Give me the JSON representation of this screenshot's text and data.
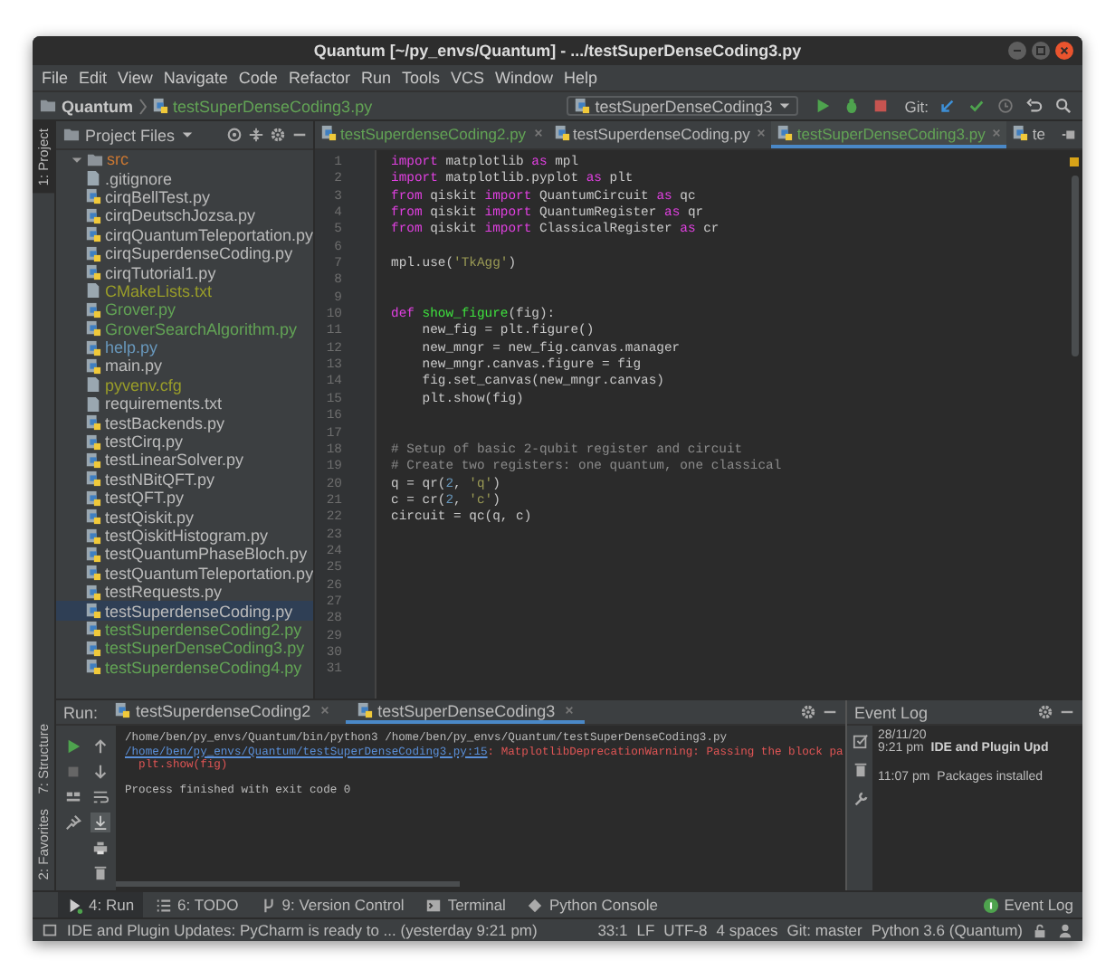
{
  "window": {
    "title": "Quantum [~/py_envs/Quantum] - .../testSuperDenseCoding3.py"
  },
  "menu": [
    "File",
    "Edit",
    "View",
    "Navigate",
    "Code",
    "Refactor",
    "Run",
    "Tools",
    "VCS",
    "Window",
    "Help"
  ],
  "navbar": {
    "project": "Quantum",
    "file": "testSuperDenseCoding3.py",
    "run_config": "testSuperDenseCoding3",
    "git_label": "Git:"
  },
  "side_tabs_top": [
    {
      "label": "1: Project",
      "selected": true
    }
  ],
  "side_tabs_bottom": [
    {
      "label": "7: Structure",
      "selected": false
    },
    {
      "label": "2: Favorites",
      "selected": false
    }
  ],
  "project_panel": {
    "title": "Project Files",
    "items": [
      {
        "name": "src",
        "kind": "folder",
        "color": "#cc7832",
        "selected": false,
        "children": [
          {
            "name": ".gitignore",
            "kind": "text",
            "color": "#bbbbbb",
            "selected": false
          },
          {
            "name": "cirqBellTest.py",
            "kind": "python",
            "color": "#bbbbbb",
            "selected": false
          },
          {
            "name": "cirqDeutschJozsa.py",
            "kind": "python",
            "color": "#bbbbbb",
            "selected": false
          },
          {
            "name": "cirqQuantumTeleportation.py",
            "kind": "python",
            "color": "#bbbbbb",
            "selected": false
          },
          {
            "name": "cirqSuperdenseCoding.py",
            "kind": "python",
            "color": "#bbbbbb",
            "selected": false
          },
          {
            "name": "cirqTutorial1.py",
            "kind": "python",
            "color": "#bbbbbb",
            "selected": false
          },
          {
            "name": "CMakeLists.txt",
            "kind": "text",
            "color": "#999d29",
            "selected": false
          },
          {
            "name": "Grover.py",
            "kind": "python",
            "color": "#62a355",
            "selected": false
          },
          {
            "name": "GroverSearchAlgorithm.py",
            "kind": "python",
            "color": "#62a355",
            "selected": false
          },
          {
            "name": "help.py",
            "kind": "python",
            "color": "#6897bb",
            "selected": false
          },
          {
            "name": "main.py",
            "kind": "python",
            "color": "#bbbbbb",
            "selected": false
          },
          {
            "name": "pyvenv.cfg",
            "kind": "text",
            "color": "#999d29",
            "selected": false
          },
          {
            "name": "requirements.txt",
            "kind": "text",
            "color": "#bbbbbb",
            "selected": false
          },
          {
            "name": "testBackends.py",
            "kind": "python",
            "color": "#bbbbbb",
            "selected": false
          },
          {
            "name": "testCirq.py",
            "kind": "python",
            "color": "#bbbbbb",
            "selected": false
          },
          {
            "name": "testLinearSolver.py",
            "kind": "python",
            "color": "#bbbbbb",
            "selected": false
          },
          {
            "name": "testNBitQFT.py",
            "kind": "python",
            "color": "#bbbbbb",
            "selected": false
          },
          {
            "name": "testQFT.py",
            "kind": "python",
            "color": "#bbbbbb",
            "selected": false
          },
          {
            "name": "testQiskit.py",
            "kind": "python",
            "color": "#bbbbbb",
            "selected": false
          },
          {
            "name": "testQiskitHistogram.py",
            "kind": "python",
            "color": "#bbbbbb",
            "selected": false
          },
          {
            "name": "testQuantumPhaseBloch.py",
            "kind": "python",
            "color": "#bbbbbb",
            "selected": false
          },
          {
            "name": "testQuantumTeleportation.py",
            "kind": "python",
            "color": "#bbbbbb",
            "selected": false
          },
          {
            "name": "testRequests.py",
            "kind": "python",
            "color": "#bbbbbb",
            "selected": false
          },
          {
            "name": "testSuperdenseCoding.py",
            "kind": "python",
            "color": "#bbbbbb",
            "selected": true
          },
          {
            "name": "testSuperdenseCoding2.py",
            "kind": "python",
            "color": "#62a355",
            "selected": false
          },
          {
            "name": "testSuperDenseCoding3.py",
            "kind": "python",
            "color": "#62a355",
            "selected": false
          },
          {
            "name": "testSuperdenseCoding4.py",
            "kind": "python",
            "color": "#62a355",
            "selected": false
          }
        ]
      }
    ]
  },
  "editor_tabs": [
    {
      "label": "testSuperdenseCoding2.py",
      "color": "#62a355",
      "selected": false
    },
    {
      "label": "testSuperdenseCoding.py",
      "color": "#bbbbbb",
      "selected": false
    },
    {
      "label": "testSuperDenseCoding3.py",
      "color": "#62a355",
      "selected": true
    },
    {
      "label": "te",
      "color": "#bbbbbb",
      "selected": false
    }
  ],
  "code": [
    {
      "n": "1",
      "tokens": [
        {
          "kind": "keyword",
          "text": "import"
        },
        {
          "kind": "plain",
          "text": " matplotlib "
        },
        {
          "kind": "keyword",
          "text": "as"
        },
        {
          "kind": "plain",
          "text": " mpl"
        }
      ]
    },
    {
      "n": "2",
      "tokens": [
        {
          "kind": "keyword",
          "text": "import"
        },
        {
          "kind": "plain",
          "text": " matplotlib.pyplot "
        },
        {
          "kind": "keyword",
          "text": "as"
        },
        {
          "kind": "plain",
          "text": " plt"
        }
      ]
    },
    {
      "n": "3",
      "tokens": [
        {
          "kind": "keyword",
          "text": "from"
        },
        {
          "kind": "plain",
          "text": " qiskit "
        },
        {
          "kind": "keyword",
          "text": "import"
        },
        {
          "kind": "plain",
          "text": " QuantumCircuit "
        },
        {
          "kind": "keyword",
          "text": "as"
        },
        {
          "kind": "plain",
          "text": " qc"
        }
      ]
    },
    {
      "n": "4",
      "tokens": [
        {
          "kind": "keyword",
          "text": "from"
        },
        {
          "kind": "plain",
          "text": " qiskit "
        },
        {
          "kind": "keyword",
          "text": "import"
        },
        {
          "kind": "plain",
          "text": " QuantumRegister "
        },
        {
          "kind": "keyword",
          "text": "as"
        },
        {
          "kind": "plain",
          "text": " qr"
        }
      ]
    },
    {
      "n": "5",
      "tokens": [
        {
          "kind": "keyword",
          "text": "from"
        },
        {
          "kind": "plain",
          "text": " qiskit "
        },
        {
          "kind": "keyword",
          "text": "import"
        },
        {
          "kind": "plain",
          "text": " ClassicalRegister "
        },
        {
          "kind": "keyword",
          "text": "as"
        },
        {
          "kind": "plain",
          "text": " cr"
        }
      ]
    },
    {
      "n": "6"
    },
    {
      "n": "7",
      "tokens": [
        {
          "kind": "plain",
          "text": "mpl.use("
        },
        {
          "kind": "string",
          "text": "'TkAgg'"
        },
        {
          "kind": "plain",
          "text": ")"
        }
      ]
    },
    {
      "n": "8"
    },
    {
      "n": "9"
    },
    {
      "n": "10",
      "tokens": [
        {
          "kind": "keyword",
          "text": "def "
        },
        {
          "kind": "function",
          "text": "show_figure"
        },
        {
          "kind": "plain",
          "text": "(fig):"
        }
      ]
    },
    {
      "n": "11",
      "tokens": [
        {
          "kind": "plain",
          "text": "    new_fig = plt.figure()"
        }
      ]
    },
    {
      "n": "12",
      "tokens": [
        {
          "kind": "plain",
          "text": "    new_mngr = new_fig.canvas.manager"
        }
      ]
    },
    {
      "n": "13",
      "tokens": [
        {
          "kind": "plain",
          "text": "    new_mngr.canvas.figure = fig"
        }
      ]
    },
    {
      "n": "14",
      "tokens": [
        {
          "kind": "plain",
          "text": "    fig.set_canvas(new_mngr.canvas)"
        }
      ]
    },
    {
      "n": "15",
      "tokens": [
        {
          "kind": "plain",
          "text": "    plt.show(fig)"
        }
      ]
    },
    {
      "n": "16"
    },
    {
      "n": "17"
    },
    {
      "n": "18",
      "tokens": [
        {
          "kind": "comment",
          "text": "# Setup of basic 2-qubit register and circuit"
        }
      ]
    },
    {
      "n": "19",
      "tokens": [
        {
          "kind": "comment",
          "text": "# Create two registers: one quantum, one classical"
        }
      ]
    },
    {
      "n": "20",
      "tokens": [
        {
          "kind": "plain",
          "text": "q = qr("
        },
        {
          "kind": "number",
          "text": "2"
        },
        {
          "kind": "plain",
          "text": ", "
        },
        {
          "kind": "string",
          "text": "'q'"
        },
        {
          "kind": "plain",
          "text": ")"
        }
      ]
    },
    {
      "n": "21",
      "tokens": [
        {
          "kind": "plain",
          "text": "c = cr("
        },
        {
          "kind": "number",
          "text": "2"
        },
        {
          "kind": "plain",
          "text": ", "
        },
        {
          "kind": "string",
          "text": "'c'"
        },
        {
          "kind": "plain",
          "text": ")"
        }
      ]
    },
    {
      "n": "22",
      "tokens": [
        {
          "kind": "plain",
          "text": "circuit = qc(q, c)"
        }
      ]
    },
    {
      "n": "23"
    },
    {
      "n": "24"
    },
    {
      "n": "25"
    },
    {
      "n": "26"
    },
    {
      "n": "27"
    },
    {
      "n": "28"
    },
    {
      "n": "29"
    },
    {
      "n": "30"
    },
    {
      "n": "31"
    }
  ],
  "run_panel": {
    "label": "Run:",
    "tabs": [
      {
        "label": "testSuperdenseCoding2",
        "selected": false
      },
      {
        "label": "testSuperDenseCoding3",
        "selected": true
      }
    ],
    "output": [
      {
        "segments": [
          {
            "kind": "plain",
            "text": "/home/ben/py_envs/Quantum/bin/python3 /home/ben/py_envs/Quantum/testSuperDenseCoding3.py"
          }
        ]
      },
      {
        "segments": [
          {
            "kind": "link",
            "text": "/home/ben/py_envs/Quantum/testSuperDenseCoding3.py:15"
          },
          {
            "kind": "error",
            "text": ": MatplotlibDeprecationWarning: Passing the block pa"
          }
        ]
      },
      {
        "segments": [
          {
            "kind": "error",
            "text": "  plt.show(fig)"
          }
        ]
      },
      {
        "segments": [
          {
            "kind": "plain",
            "text": "Process finished with exit code 0"
          }
        ]
      }
    ]
  },
  "event_log": {
    "title": "Event Log",
    "date": "28/11/20",
    "entries": [
      {
        "time": "9:21 pm",
        "text": "IDE and Plugin Upd",
        "bold": true
      },
      {
        "time": "11:07 pm",
        "text": "Packages installed",
        "bold": false
      }
    ]
  },
  "tool_buttons": [
    {
      "label": "4: Run",
      "kind": "run",
      "selected": true
    },
    {
      "label": "6: TODO",
      "kind": "todo",
      "selected": false
    },
    {
      "label": "9: Version Control",
      "kind": "vcs",
      "selected": false
    },
    {
      "label": "Terminal",
      "kind": "terminal",
      "selected": false
    },
    {
      "label": "Python Console",
      "kind": "console",
      "selected": false
    },
    {
      "label": "Event Log",
      "kind": "eventlog",
      "selected": false
    }
  ],
  "status_bar": {
    "message": "IDE and Plugin Updates: PyCharm is ready to ... (yesterday 9:21 pm)",
    "items": [
      "33:1",
      "LF",
      "UTF-8",
      "4 spaces",
      "Git: master",
      "Python 3.6 (Quantum)"
    ]
  }
}
